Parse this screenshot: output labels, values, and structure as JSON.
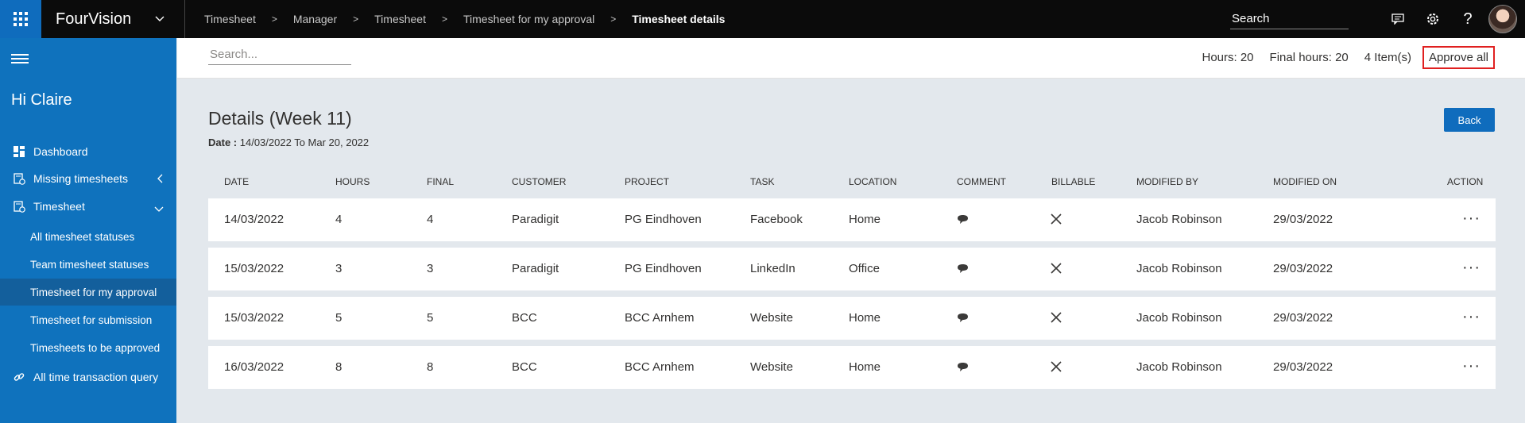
{
  "topbar": {
    "app_title": "FourVision",
    "breadcrumb": [
      "Timesheet",
      "Manager",
      "Timesheet",
      "Timesheet for my approval",
      "Timesheet details"
    ],
    "search_placeholder": "Search"
  },
  "sidebar": {
    "greeting": "Hi Claire",
    "items": [
      {
        "label": "Dashboard",
        "icon": "dashboard-icon"
      },
      {
        "label": "Missing timesheets",
        "icon": "timesheet-icon"
      },
      {
        "label": "Timesheet",
        "icon": "timesheet-icon"
      }
    ],
    "sub_items": [
      "All timesheet statuses",
      "Team timesheet statuses",
      "Timesheet for my approval",
      "Timesheet for submission",
      "Timesheets to be approved"
    ],
    "extra_item": "All time transaction query"
  },
  "cmdbar": {
    "search_placeholder": "Search...",
    "hours": "Hours: 20",
    "final_hours": "Final hours: 20",
    "items_count": "4 Item(s)",
    "approve_all": "Approve all"
  },
  "main": {
    "title": "Details (Week 11)",
    "date_label": "Date :",
    "date_value": "14/03/2022 To Mar 20, 2022",
    "back_label": "Back"
  },
  "table": {
    "headers": [
      "DATE",
      "HOURS",
      "FINAL",
      "CUSTOMER",
      "PROJECT",
      "TASK",
      "LOCATION",
      "COMMENT",
      "BILLABLE",
      "MODIFIED BY",
      "MODIFIED ON",
      "ACTION"
    ],
    "rows": [
      {
        "date": "14/03/2022",
        "hours": "4",
        "final": "4",
        "customer": "Paradigit",
        "project": "PG Eindhoven",
        "task": "Facebook",
        "location": "Home",
        "modified_by": "Jacob Robinson",
        "modified_on": "29/03/2022"
      },
      {
        "date": "15/03/2022",
        "hours": "3",
        "final": "3",
        "customer": "Paradigit",
        "project": "PG Eindhoven",
        "task": "LinkedIn",
        "location": "Office",
        "modified_by": "Jacob Robinson",
        "modified_on": "29/03/2022"
      },
      {
        "date": "15/03/2022",
        "hours": "5",
        "final": "5",
        "customer": "BCC",
        "project": "BCC Arnhem",
        "task": "Website",
        "location": "Home",
        "modified_by": "Jacob Robinson",
        "modified_on": "29/03/2022"
      },
      {
        "date": "16/03/2022",
        "hours": "8",
        "final": "8",
        "customer": "BCC",
        "project": "BCC Arnhem",
        "task": "Website",
        "location": "Home",
        "modified_by": "Jacob Robinson",
        "modified_on": "29/03/2022"
      }
    ],
    "action_glyph": "···"
  },
  "colors": {
    "topbar": "#0b0b0b",
    "sidebar": "#0f72bd",
    "sidebar_active": "#135f9c",
    "accent": "#0f6cbd",
    "highlight_border": "#e02020",
    "content_bg": "#e3e8ed"
  }
}
